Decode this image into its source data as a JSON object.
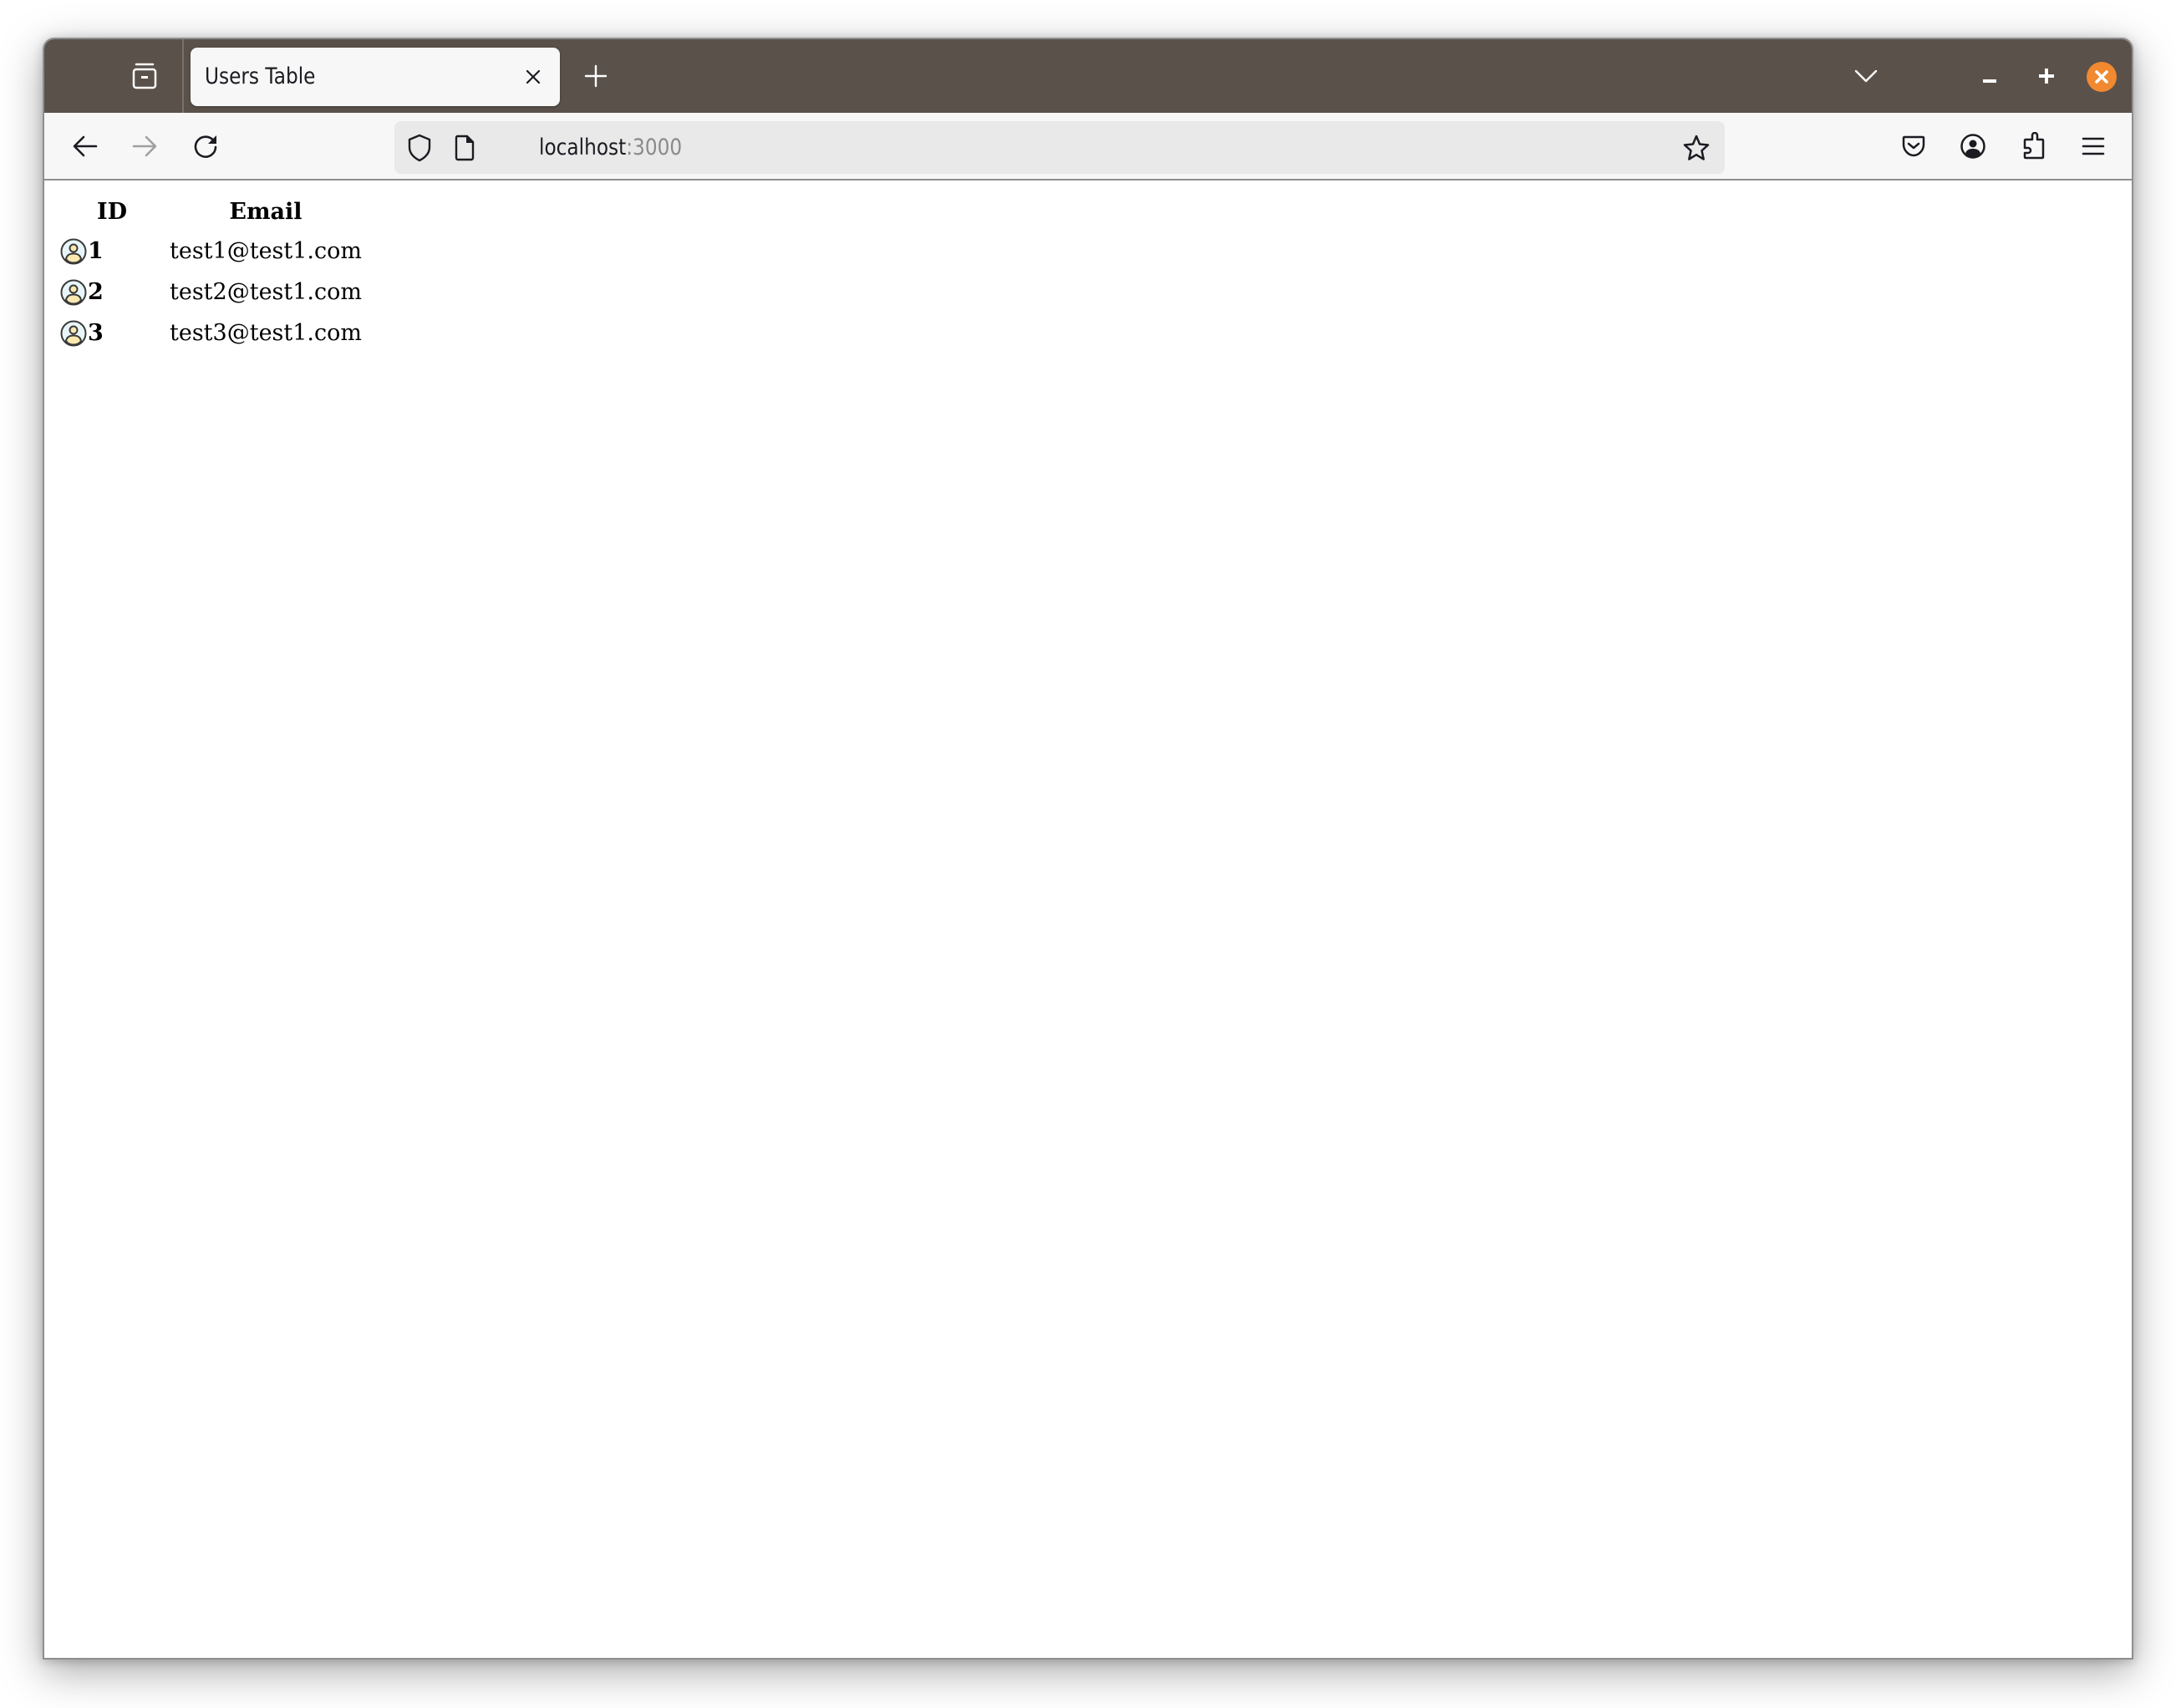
{
  "browser": {
    "tab": {
      "title": "Users Table",
      "close_icon": "close-icon"
    },
    "new_tab_icon": "plus-icon",
    "list_tabs_icon": "chevron-down-icon",
    "window_controls": {
      "minimize": "minimize-icon",
      "maximize": "maximize-icon",
      "close": "close-icon",
      "close_color": "#f0892f"
    },
    "toolbar": {
      "back_icon": "arrow-left-icon",
      "forward_icon": "arrow-right-icon",
      "reload_icon": "reload-icon",
      "url_host": "localhost",
      "url_port": ":3000",
      "bookmark_icon": "star-icon",
      "pocket_icon": "pocket-icon",
      "account_icon": "account-icon",
      "extensions_icon": "puzzle-icon",
      "menu_icon": "hamburger-menu-icon"
    },
    "colors": {
      "tabbar_bg": "#5a514b",
      "toolbar_bg": "#f7f7f7",
      "urlbar_bg": "#e9e9e9"
    }
  },
  "page": {
    "table": {
      "headers": [
        "ID",
        "Email"
      ],
      "rows": [
        {
          "id": "1",
          "email": "test1@test1.com",
          "icon": "user-avatar-icon"
        },
        {
          "id": "2",
          "email": "test2@test1.com",
          "icon": "user-avatar-icon"
        },
        {
          "id": "3",
          "email": "test3@test1.com",
          "icon": "user-avatar-icon"
        }
      ]
    }
  }
}
